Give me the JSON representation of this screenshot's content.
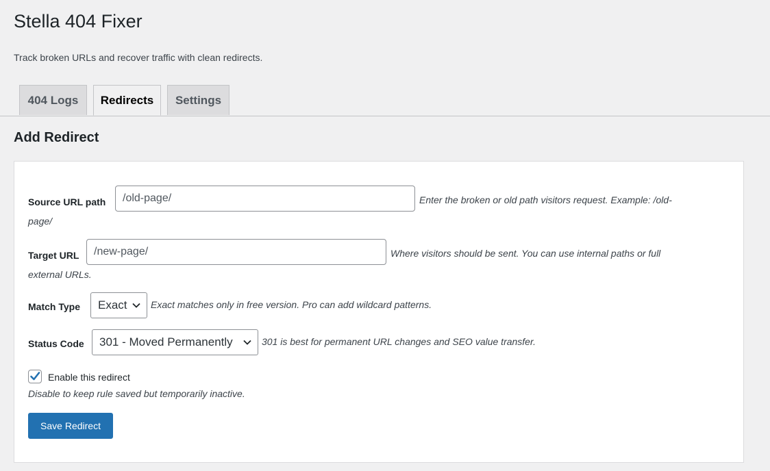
{
  "page": {
    "title": "Stella 404 Fixer",
    "description": "Track broken URLs and recover traffic with clean redirects."
  },
  "tabs": [
    {
      "label": "404 Logs",
      "active": false
    },
    {
      "label": "Redirects",
      "active": true
    },
    {
      "label": "Settings",
      "active": false
    }
  ],
  "section": {
    "title": "Add Redirect"
  },
  "form": {
    "source": {
      "label": "Source URL path",
      "placeholder": "/old-page/",
      "value": "",
      "hint_line1": "Enter the broken or old path visitors request. Example: /old-",
      "hint_line2": "page/"
    },
    "target": {
      "label": "Target URL",
      "placeholder": "/new-page/",
      "value": "",
      "hint_line1": "Where visitors should be sent. You can use internal paths or full",
      "hint_line2": "external URLs."
    },
    "match_type": {
      "label": "Match Type",
      "selected": "Exact",
      "hint": "Exact matches only in free version. Pro can add wildcard patterns."
    },
    "status_code": {
      "label": "Status Code",
      "selected": "301 - Moved Permanently",
      "hint": "301 is best for permanent URL changes and SEO value transfer."
    },
    "enabled": {
      "label": "Enable this redirect",
      "checked": true,
      "description": "Disable to keep rule saved but temporarily inactive."
    },
    "save_label": "Save Redirect"
  },
  "colors": {
    "primary": "#2271b1",
    "background": "#f0f0f1",
    "checkmark": "#2271b1"
  },
  "icons": {
    "select_arrow": "chevron-down-icon",
    "checkbox": "checkmark-icon"
  }
}
